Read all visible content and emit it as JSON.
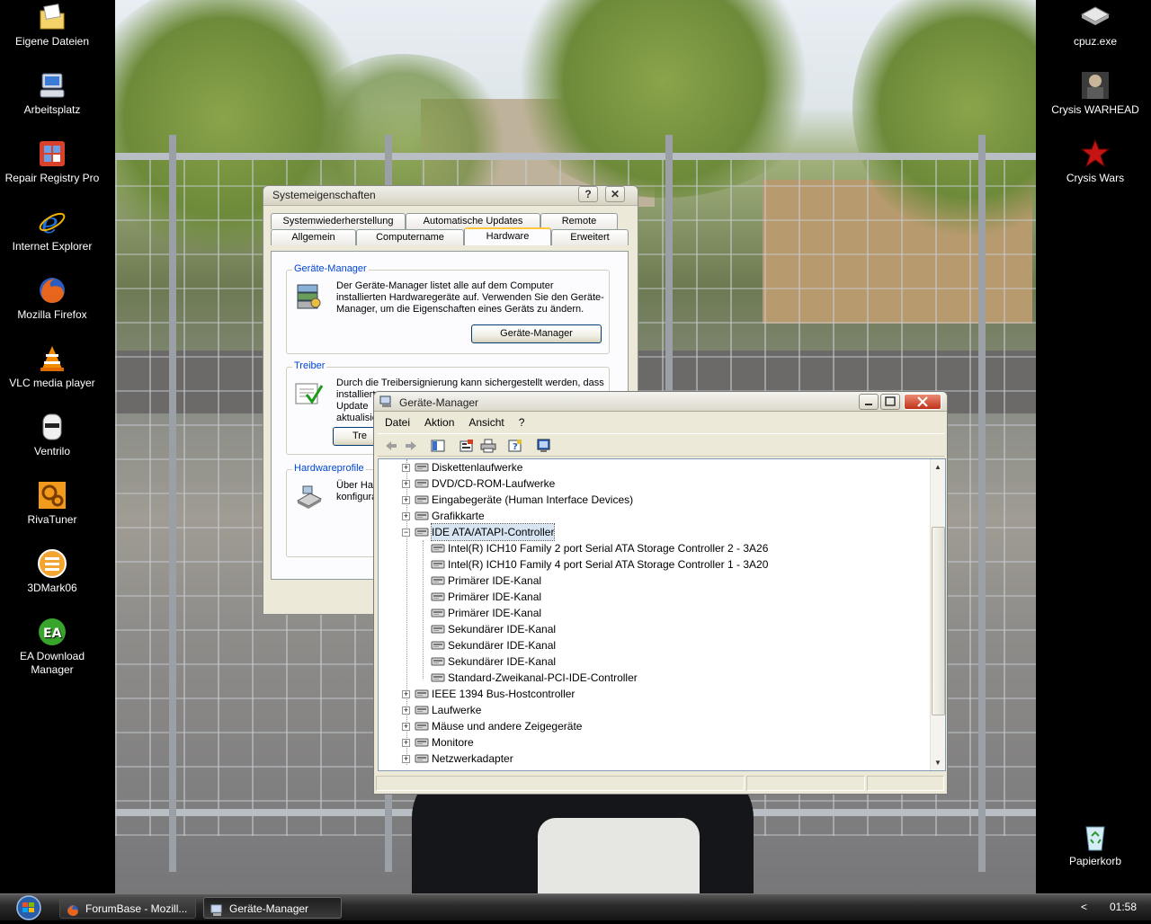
{
  "desktop": {
    "left_icons": [
      {
        "label": "Eigene Dateien",
        "icon": "folder-documents-icon"
      },
      {
        "label": "Arbeitsplatz",
        "icon": "my-computer-icon"
      },
      {
        "label": "Repair Registry Pro",
        "icon": "repair-registry-icon"
      },
      {
        "label": "Internet Explorer",
        "icon": "internet-explorer-icon"
      },
      {
        "label": "Mozilla Firefox",
        "icon": "firefox-icon"
      },
      {
        "label": "VLC media player",
        "icon": "vlc-icon"
      },
      {
        "label": "Ventrilo",
        "icon": "ventrilo-icon"
      },
      {
        "label": "RivaTuner",
        "icon": "rivatuner-icon"
      },
      {
        "label": "3DMark06",
        "icon": "3dmark-icon"
      },
      {
        "label": "EA Download Manager",
        "icon": "ea-download-manager-icon"
      }
    ],
    "right_icons": [
      {
        "label": "cpuz.exe",
        "icon": "cpuz-icon"
      },
      {
        "label": "Crysis WARHEAD",
        "icon": "crysis-warhead-icon"
      },
      {
        "label": "Crysis Wars",
        "icon": "crysis-wars-icon"
      },
      {
        "label": "Papierkorb",
        "icon": "recycle-bin-icon"
      }
    ]
  },
  "sysprops": {
    "title": "Systemeigenschaften",
    "help_btn": "?",
    "close_btn": "✕",
    "tabs_row1": [
      "Systemwiederherstellung",
      "Automatische Updates",
      "Remote"
    ],
    "tabs_row2": [
      "Allgemein",
      "Computername",
      "Hardware",
      "Erweitert"
    ],
    "active_tab": "Hardware",
    "groups": {
      "devmgr": {
        "title": "Geräte-Manager",
        "text": "Der Geräte-Manager listet alle auf dem Computer installierten Hardwaregeräte auf. Verwenden Sie den Geräte-Manager, um die Eigenschaften eines Geräts zu ändern.",
        "button": "Geräte-Manager"
      },
      "driver": {
        "title": "Treiber",
        "text_line1": "Durch die Treibersignierung kann sichergestellt werden, dass",
        "text_line2": "installiert",
        "text_line3": "Update",
        "text_line4": "aktualisie",
        "button": "Tre"
      },
      "hwprofiles": {
        "title": "Hardwareprofile",
        "text_line1": "Über Ha",
        "text_line2": "konfigura"
      }
    }
  },
  "devmgr": {
    "title": "Geräte-Manager",
    "menu": [
      "Datei",
      "Aktion",
      "Ansicht",
      "?"
    ],
    "toolbar": [
      "back-icon",
      "forward-icon",
      "show-hide-console-tree-icon",
      "properties-icon",
      "print-icon",
      "help-icon",
      "scan-hardware-icon"
    ],
    "tree": [
      {
        "label": "Diskettenlaufwerke",
        "level": 1,
        "expander": "+",
        "icon": "floppy-drive-icon"
      },
      {
        "label": "DVD/CD-ROM-Laufwerke",
        "level": 1,
        "expander": "+",
        "icon": "cd-drive-icon"
      },
      {
        "label": "Eingabegeräte (Human Interface Devices)",
        "level": 1,
        "expander": "+",
        "icon": "hid-icon"
      },
      {
        "label": "Grafikkarte",
        "level": 1,
        "expander": "+",
        "icon": "display-adapter-icon"
      },
      {
        "label": "IDE ATA/ATAPI-Controller",
        "level": 1,
        "expander": "−",
        "icon": "ide-controller-icon",
        "selected": true
      },
      {
        "label": "Intel(R) ICH10 Family 2 port Serial ATA Storage Controller 2 - 3A26",
        "level": 2,
        "icon": "ide-controller-icon"
      },
      {
        "label": "Intel(R) ICH10 Family 4 port Serial ATA Storage Controller 1 - 3A20",
        "level": 2,
        "icon": "ide-controller-icon"
      },
      {
        "label": "Primärer IDE-Kanal",
        "level": 2,
        "icon": "ide-controller-icon"
      },
      {
        "label": "Primärer IDE-Kanal",
        "level": 2,
        "icon": "ide-controller-icon"
      },
      {
        "label": "Primärer IDE-Kanal",
        "level": 2,
        "icon": "ide-controller-icon"
      },
      {
        "label": "Sekundärer IDE-Kanal",
        "level": 2,
        "icon": "ide-controller-icon"
      },
      {
        "label": "Sekundärer IDE-Kanal",
        "level": 2,
        "icon": "ide-controller-icon"
      },
      {
        "label": "Sekundärer IDE-Kanal",
        "level": 2,
        "icon": "ide-controller-icon"
      },
      {
        "label": "Standard-Zweikanal-PCI-IDE-Controller",
        "level": 2,
        "icon": "ide-controller-icon"
      },
      {
        "label": "IEEE 1394 Bus-Hostcontroller",
        "level": 1,
        "expander": "+",
        "icon": "ieee1394-icon"
      },
      {
        "label": "Laufwerke",
        "level": 1,
        "expander": "+",
        "icon": "disk-drive-icon"
      },
      {
        "label": "Mäuse und andere Zeigegeräte",
        "level": 1,
        "expander": "+",
        "icon": "mouse-icon"
      },
      {
        "label": "Monitore",
        "level": 1,
        "expander": "+",
        "icon": "monitor-icon"
      },
      {
        "label": "Netzwerkadapter",
        "level": 1,
        "expander": "+",
        "icon": "network-adapter-icon"
      }
    ]
  },
  "taskbar": {
    "tasks": [
      {
        "label": "ForumBase - Mozill...",
        "icon": "firefox-icon",
        "active": false
      },
      {
        "label": "Geräte-Manager",
        "icon": "device-manager-icon",
        "active": true
      }
    ],
    "tray_arrow": "<",
    "clock": "01:58"
  },
  "colors": {
    "titlebar_gray": "#d7d3c3",
    "xp_face": "#ece9d8",
    "selection": "#d7e4f2",
    "group_title": "#0046d5",
    "close_red": "#c1321a"
  }
}
